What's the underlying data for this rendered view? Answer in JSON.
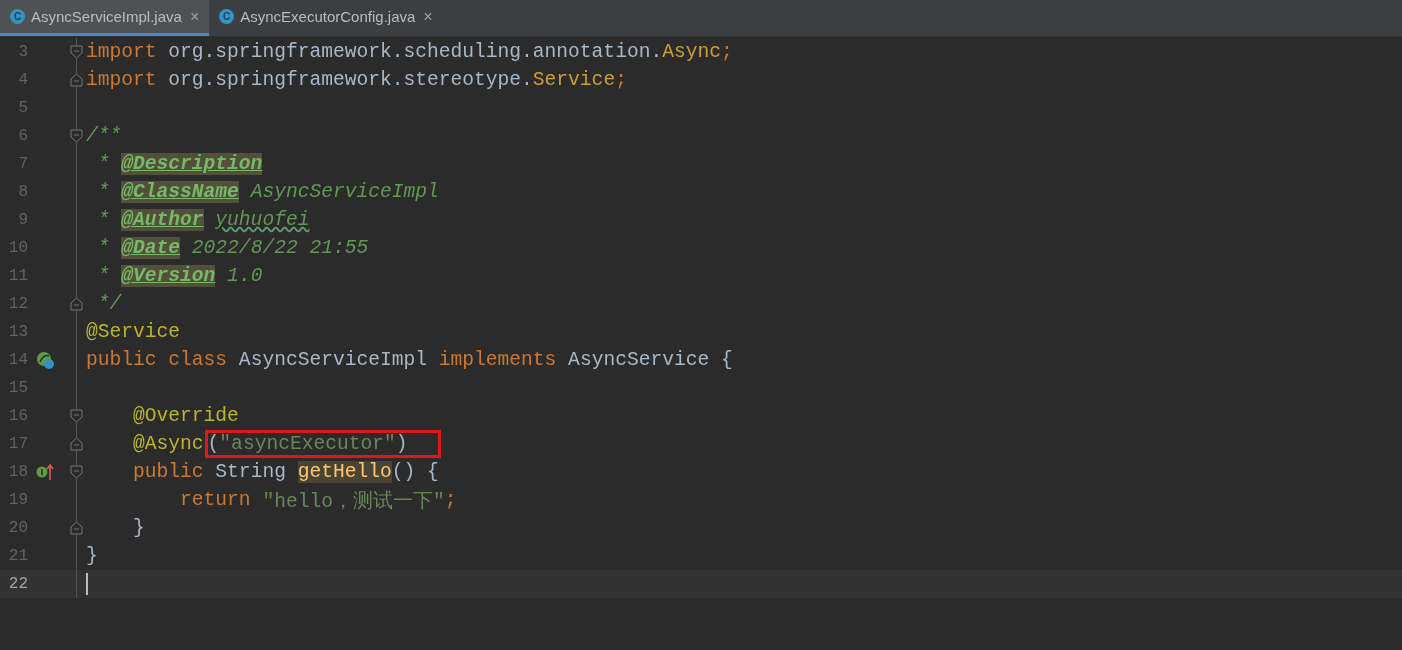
{
  "tabs": [
    {
      "icon": "C",
      "label": "AsyncServiceImpl.java",
      "close": "×",
      "selected": true
    },
    {
      "icon": "C",
      "label": "AsyncExecutorConfig.java",
      "close": "×",
      "selected": false
    }
  ],
  "lines": [
    {
      "number": "3",
      "fold_start": true,
      "tokens": [
        {
          "kind": "keyword",
          "text": "import"
        },
        {
          "kind": "plain",
          "text": " org.springframework.scheduling.annotation."
        },
        {
          "kind": "annotation_ref",
          "text": "Async"
        },
        {
          "kind": "keyword",
          "text": ";"
        }
      ]
    },
    {
      "number": "4",
      "fold_end": true,
      "tokens": [
        {
          "kind": "keyword",
          "text": "import"
        },
        {
          "kind": "plain",
          "text": " org.springframework.stereotype."
        },
        {
          "kind": "annotation_ref",
          "text": "Service"
        },
        {
          "kind": "keyword",
          "text": ";"
        }
      ]
    },
    {
      "number": "5"
    },
    {
      "number": "6",
      "fold_start": true,
      "tokens": [
        {
          "kind": "doc",
          "text": "/**"
        }
      ]
    },
    {
      "number": "7",
      "tokens": [
        {
          "kind": "doc",
          "text": " * "
        },
        {
          "kind": "doc_tag",
          "text": "@Description"
        }
      ]
    },
    {
      "number": "8",
      "tokens": [
        {
          "kind": "doc",
          "text": " * "
        },
        {
          "kind": "doc_tag",
          "text": "@ClassName"
        },
        {
          "kind": "doc",
          "text": " AsyncServiceImpl"
        }
      ]
    },
    {
      "number": "9",
      "tokens": [
        {
          "kind": "doc",
          "text": " * "
        },
        {
          "kind": "doc_tag",
          "text": "@Author"
        },
        {
          "kind": "doc_typo",
          "text": "yuhuofei"
        }
      ]
    },
    {
      "number": "10",
      "tokens": [
        {
          "kind": "doc",
          "text": " * "
        },
        {
          "kind": "doc_tag",
          "text": "@Date"
        },
        {
          "kind": "doc",
          "text": " 2022/8/22 21:55"
        }
      ]
    },
    {
      "number": "11",
      "tokens": [
        {
          "kind": "doc",
          "text": " * "
        },
        {
          "kind": "doc_tag",
          "text": "@Version"
        },
        {
          "kind": "doc",
          "text": " 1.0"
        }
      ]
    },
    {
      "number": "12",
      "fold_end": true,
      "tokens": [
        {
          "kind": "doc",
          "text": " */"
        }
      ]
    },
    {
      "number": "13",
      "tokens": [
        {
          "kind": "annotation",
          "text": "@Service"
        }
      ]
    },
    {
      "number": "14",
      "bean_marker": true,
      "tokens": [
        {
          "kind": "keyword",
          "text": "public class"
        },
        {
          "kind": "plain",
          "text": " AsyncServiceImpl "
        },
        {
          "kind": "keyword",
          "text": "implements"
        },
        {
          "kind": "plain",
          "text": " AsyncService {"
        }
      ]
    },
    {
      "number": "15"
    },
    {
      "number": "16",
      "fold_start": true,
      "tokens": [
        {
          "kind": "annotation",
          "text": "    @Override"
        }
      ]
    },
    {
      "number": "17",
      "fold_end": true,
      "tokens": [
        {
          "kind": "annotation",
          "text": "    @Async"
        },
        {
          "kind": "boxed",
          "parts": [
            {
              "kind": "plain",
              "text": "("
            },
            {
              "kind": "string",
              "text": "\"asyncExecutor\""
            },
            {
              "kind": "plain",
              "text": ")"
            }
          ]
        }
      ]
    },
    {
      "number": "18",
      "override_marker": true,
      "fold_start": true,
      "tokens": [
        {
          "kind": "keyword",
          "text": "    public"
        },
        {
          "kind": "plain",
          "text": " String "
        },
        {
          "kind": "usage",
          "text": "getHello"
        },
        {
          "kind": "plain",
          "text": "() {"
        }
      ]
    },
    {
      "number": "19",
      "tokens": [
        {
          "kind": "keyword",
          "text": "        return"
        },
        {
          "kind": "string",
          "text": " \"hello，测试一下\""
        },
        {
          "kind": "keyword",
          "text": ";"
        }
      ]
    },
    {
      "number": "20",
      "fold_end": true,
      "tokens": [
        {
          "kind": "plain",
          "text": "    }"
        }
      ]
    },
    {
      "number": "21",
      "tokens": [
        {
          "kind": "plain",
          "text": "}"
        }
      ]
    },
    {
      "number": "22",
      "current": true
    }
  ]
}
